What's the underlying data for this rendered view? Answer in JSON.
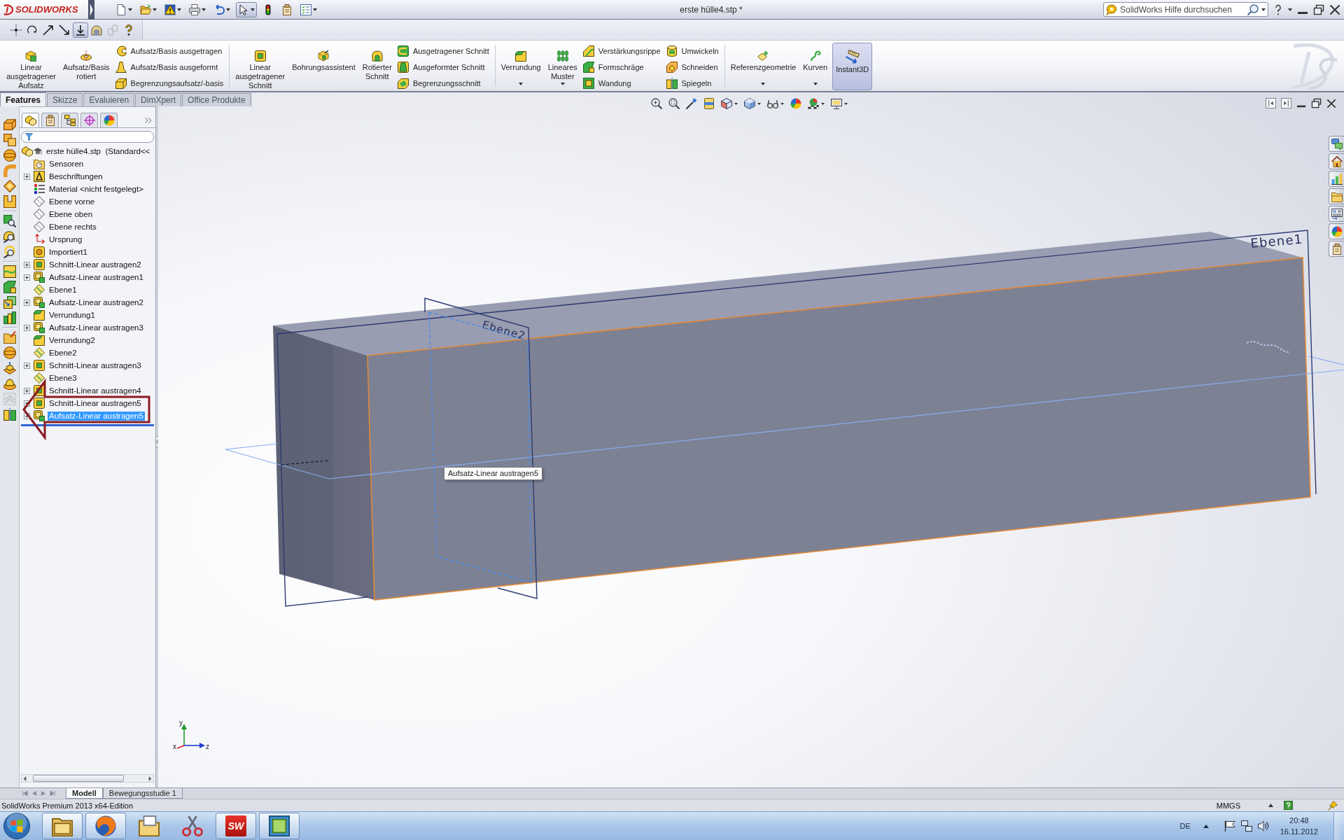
{
  "title_bar": {
    "logo": "SOLIDWORKS",
    "title": "erste hülle4.stp *",
    "search": {
      "placeholder": "SolidWorks Hilfe durchsuchen"
    }
  },
  "quick_access": [
    {
      "pressed": false
    },
    {
      "pressed": false
    },
    {
      "pressed": false
    },
    {
      "pressed": false
    },
    {
      "pressed": false
    },
    {
      "pressed": true
    },
    {
      "pressed": false
    },
    {
      "pressed": false
    },
    {
      "pressed": false
    }
  ],
  "sketch_toolbar": [
    {
      "pressed": false,
      "disabled": false
    },
    {
      "pressed": false,
      "disabled": false
    },
    {
      "pressed": false,
      "disabled": false
    },
    {
      "pressed": false,
      "disabled": false
    },
    {
      "pressed": true,
      "disabled": false
    },
    {
      "pressed": false,
      "disabled": false
    },
    {
      "pressed": false,
      "disabled": true
    },
    {
      "pressed": false,
      "disabled": false
    }
  ],
  "command_manager": {
    "groups": [
      {
        "items": [
          {
            "kind": "large",
            "label": "Linear ausgetragener Aufsatz",
            "menu": false
          },
          {
            "kind": "large",
            "label": "Aufsatz/Basis rotiert",
            "menu": false
          },
          {
            "kind": "stack",
            "entries": [
              "Aufsatz/Basis ausgetragen",
              "Aufsatz/Basis ausgeformt",
              "Begrenzungsaufsatz/-basis"
            ]
          }
        ]
      },
      {
        "items": [
          {
            "kind": "large",
            "label": "Linear ausgetragener Schnitt",
            "menu": false
          },
          {
            "kind": "large",
            "label": "Bohrungsassistent",
            "menu": false
          },
          {
            "kind": "large",
            "label": "Rotierter Schnitt",
            "menu": false
          },
          {
            "kind": "stack",
            "entries": [
              "Ausgetragener Schnitt",
              "Ausgeformter Schnitt",
              "Begrenzungsschnitt"
            ]
          }
        ]
      },
      {
        "items": [
          {
            "kind": "large",
            "label": "Verrundung",
            "menu": true
          },
          {
            "kind": "large",
            "label": "Lineares Muster",
            "menu": true
          },
          {
            "kind": "stack",
            "entries": [
              "Verstärkungsrippe",
              "Formschräge",
              "Wandung"
            ]
          },
          {
            "kind": "stack",
            "entries": [
              "Umwickeln",
              "Schneiden",
              "Spiegeln"
            ]
          }
        ]
      },
      {
        "items": [
          {
            "kind": "large",
            "label": "Referenzgeometrie",
            "menu": true
          },
          {
            "kind": "large",
            "label": "Kurven",
            "menu": true
          },
          {
            "kind": "toggle",
            "label": "Instant3D",
            "on": true
          }
        ]
      }
    ]
  },
  "tabs": [
    {
      "label": "Features",
      "selected": true
    },
    {
      "label": "Skizze",
      "selected": false
    },
    {
      "label": "Evaluieren",
      "selected": false
    },
    {
      "label": "DimXpert",
      "selected": false
    },
    {
      "label": "Office Produkte",
      "selected": false
    }
  ],
  "feature_toolbar": [
    {
      "disabled": false
    },
    {
      "disabled": false
    },
    {
      "disabled": false
    },
    {
      "disabled": false
    },
    {
      "disabled": false
    },
    {
      "disabled": false
    },
    {
      "disabled": false
    },
    {
      "disabled": false
    },
    {
      "disabled": false
    },
    {
      "disabled": false
    },
    {
      "disabled": false
    },
    {
      "disabled": false
    },
    {
      "disabled": false
    },
    {
      "disabled": false
    },
    {
      "disabled": false
    },
    {
      "disabled": false
    },
    {
      "disabled": false
    },
    {
      "disabled": true
    },
    {
      "disabled": false
    }
  ],
  "panel_tabs": [
    {
      "selected": true
    },
    {
      "selected": false
    },
    {
      "selected": false
    },
    {
      "selected": false
    },
    {
      "selected": false
    }
  ],
  "feature_tree": {
    "label": "erste hülle4.stp  (Standard<<",
    "kind": "part",
    "selected": false,
    "children": [
      {
        "label": "Sensoren",
        "kind": "sensors",
        "expandable": false,
        "selected": false
      },
      {
        "label": "Beschriftungen",
        "kind": "annotations",
        "expandable": true,
        "selected": false
      },
      {
        "label": "Material <nicht festgelegt>",
        "kind": "material",
        "expandable": false,
        "selected": false
      },
      {
        "label": "Ebene vorne",
        "kind": "plane",
        "expandable": false,
        "selected": false
      },
      {
        "label": "Ebene oben",
        "kind": "plane",
        "expandable": false,
        "selected": false
      },
      {
        "label": "Ebene rechts",
        "kind": "plane",
        "expandable": false,
        "selected": false
      },
      {
        "label": "Ursprung",
        "kind": "origin",
        "expandable": false,
        "selected": false
      },
      {
        "label": "Importiert1",
        "kind": "imported",
        "expandable": false,
        "selected": false
      },
      {
        "label": "Schnitt-Linear austragen2",
        "kind": "cut",
        "expandable": true,
        "selected": false
      },
      {
        "label": "Aufsatz-Linear austragen1",
        "kind": "boss",
        "expandable": true,
        "selected": false
      },
      {
        "label": "Ebene1",
        "kind": "refplane",
        "expandable": false,
        "selected": false
      },
      {
        "label": "Aufsatz-Linear austragen2",
        "kind": "boss",
        "expandable": true,
        "selected": false
      },
      {
        "label": "Verrundung1",
        "kind": "fillet",
        "expandable": false,
        "selected": false
      },
      {
        "label": "Aufsatz-Linear austragen3",
        "kind": "boss",
        "expandable": true,
        "selected": false
      },
      {
        "label": "Verrundung2",
        "kind": "fillet",
        "expandable": false,
        "selected": false
      },
      {
        "label": "Ebene2",
        "kind": "refplane",
        "expandable": false,
        "selected": false
      },
      {
        "label": "Schnitt-Linear austragen3",
        "kind": "cut",
        "expandable": true,
        "selected": false
      },
      {
        "label": "Ebene3",
        "kind": "refplane",
        "expandable": false,
        "selected": false
      },
      {
        "label": "Schnitt-Linear austragen4",
        "kind": "cut",
        "expandable": true,
        "selected": false
      },
      {
        "label": "Schnitt-Linear austragen5",
        "kind": "cut",
        "expandable": true,
        "selected": false
      },
      {
        "label": "Aufsatz-Linear austragen5",
        "kind": "boss",
        "expandable": true,
        "selected": true
      }
    ]
  },
  "viewport": {
    "planes": [
      {
        "label": "Ebene1"
      },
      {
        "label": "Ebene2"
      }
    ],
    "tooltip": "Aufsatz-Linear austragen5",
    "triad": [
      "y",
      "x",
      "z"
    ]
  },
  "bottom_tabs": [
    {
      "label": "Modell",
      "selected": true
    },
    {
      "label": "Bewegungsstudie 1",
      "selected": false
    }
  ],
  "status_bar": {
    "text": "SolidWorks Premium 2013 x64-Edition",
    "units": "MMGS"
  },
  "taskbar": {
    "apps": [
      {
        "running": true
      },
      {
        "running": true
      },
      {
        "running": false
      },
      {
        "running": false
      },
      {
        "running": true,
        "label": "SW"
      },
      {
        "running": true
      }
    ],
    "language": "DE",
    "time": "20:48",
    "date": "16.11.2012"
  }
}
